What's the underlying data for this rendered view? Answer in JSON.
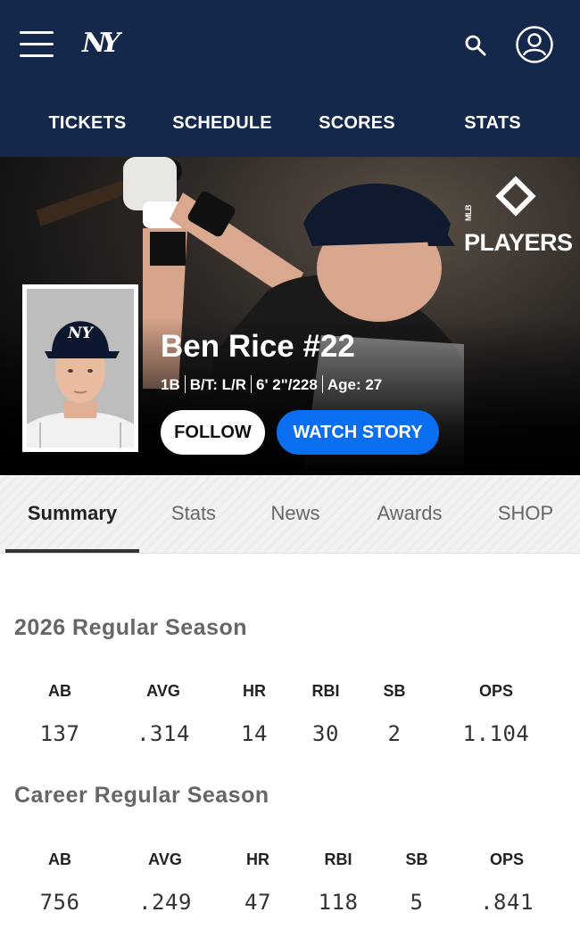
{
  "header": {
    "logo_text": "NY",
    "icons": [
      "menu-icon",
      "search-icon",
      "user-icon"
    ]
  },
  "nav": {
    "items": [
      "TICKETS",
      "SCHEDULE",
      "SCORES",
      "STATS"
    ]
  },
  "hero": {
    "partner_logo_text": "PLAYERS",
    "partner_logo_prefix": "MLB",
    "player_name": "Ben Rice #22",
    "position": "1B",
    "bats_throws": "B/T: L/R",
    "height_weight": "6' 2\"/228",
    "age": "Age: 27",
    "follow_label": "FOLLOW",
    "watch_label": "WATCH STORY",
    "colors": {
      "primary": "#13284b",
      "watch_button": "#0a6ef0"
    }
  },
  "tabs": {
    "items": [
      "Summary",
      "Stats",
      "News",
      "Awards",
      "SHOP"
    ],
    "active": "Summary"
  },
  "season": {
    "title": "2026 Regular Season",
    "headers": [
      "AB",
      "AVG",
      "HR",
      "RBI",
      "SB",
      "OPS"
    ],
    "values": [
      "137",
      ".314",
      "14",
      "30",
      "2",
      "1.104"
    ]
  },
  "career": {
    "title": "Career Regular Season",
    "headers": [
      "AB",
      "AVG",
      "HR",
      "RBI",
      "SB",
      "OPS"
    ],
    "values": [
      "756",
      ".249",
      "47",
      "118",
      "5",
      ".841"
    ]
  }
}
